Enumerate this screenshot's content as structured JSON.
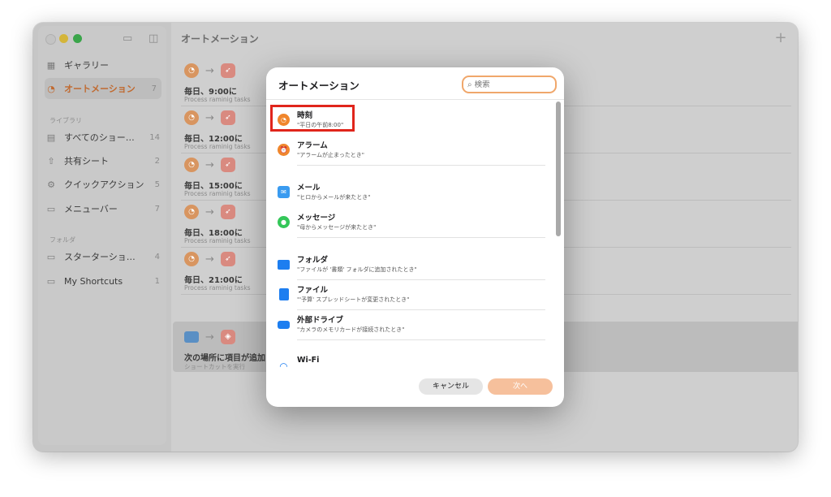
{
  "window": {
    "title": "オートメーション"
  },
  "sidebar": {
    "top_items": [
      {
        "label": "ギャラリー",
        "icon": "grid-icon",
        "count": ""
      },
      {
        "label": "オートメーション",
        "icon": "clock-icon",
        "count": "7"
      }
    ],
    "library_label": "ライブラリ",
    "library_items": [
      {
        "label": "すべてのショー…",
        "icon": "stack-icon",
        "count": "14"
      },
      {
        "label": "共有シート",
        "icon": "share-icon",
        "count": "2"
      },
      {
        "label": "クイックアクション",
        "icon": "gear-icon",
        "count": "5"
      },
      {
        "label": "メニューバー",
        "icon": "menubar-icon",
        "count": "7"
      }
    ],
    "folders_label": "フォルダ",
    "folder_items": [
      {
        "label": "スターターショ…",
        "icon": "folder-icon",
        "count": "4"
      },
      {
        "label": "My Shortcuts",
        "icon": "folder-icon",
        "count": "1"
      }
    ]
  },
  "automations": [
    {
      "title": "毎日、9:00に",
      "subtitle": "Process raminig tasks"
    },
    {
      "title": "毎日、12:00に",
      "subtitle": "Process raminig tasks"
    },
    {
      "title": "毎日、15:00に",
      "subtitle": "Process raminig tasks"
    },
    {
      "title": "毎日、18:00に",
      "subtitle": "Process raminig tasks"
    },
    {
      "title": "毎日、21:00に",
      "subtitle": "Process raminig tasks"
    },
    {
      "title": "次の場所に項目が追加され",
      "subtitle": "ショートカットを実行"
    }
  ],
  "modal": {
    "title": "オートメーション",
    "search_placeholder": "検索",
    "triggers": [
      {
        "name": "時刻",
        "desc": "\"平日の午前8:00\"",
        "icon": "clock-icon",
        "color": "#f0862c"
      },
      {
        "name": "アラーム",
        "desc": "\"アラームが止まったとき\"",
        "icon": "alarm-icon",
        "color": "#f0862c"
      },
      {
        "name": "メール",
        "desc": "\"ヒロからメールが来たとき\"",
        "icon": "mail-icon",
        "color": "#3a9bf0"
      },
      {
        "name": "メッセージ",
        "desc": "\"母からメッセージが来たとき\"",
        "icon": "message-icon",
        "color": "#34c759"
      },
      {
        "name": "フォルダ",
        "desc": "\"ファイルが '書類' フォルダに追加されたとき\"",
        "icon": "folder-icon",
        "color": "#1d7ef0"
      },
      {
        "name": "ファイル",
        "desc": "\"'予算' スプレッドシートが変更されたとき\"",
        "icon": "file-icon",
        "color": "#1d7ef0"
      },
      {
        "name": "外部ドライブ",
        "desc": "\"カメラのメモリカードが接続されたとき\"",
        "icon": "drive-icon",
        "color": "#1d7ef0"
      },
      {
        "name": "Wi-Fi",
        "desc": "",
        "icon": "wifi-icon",
        "color": "#1d7ef0"
      }
    ],
    "cancel_label": "キャンセル",
    "next_label": "次へ"
  },
  "colors": {
    "accent": "#f0a76b",
    "highlight": "#e0251b"
  }
}
